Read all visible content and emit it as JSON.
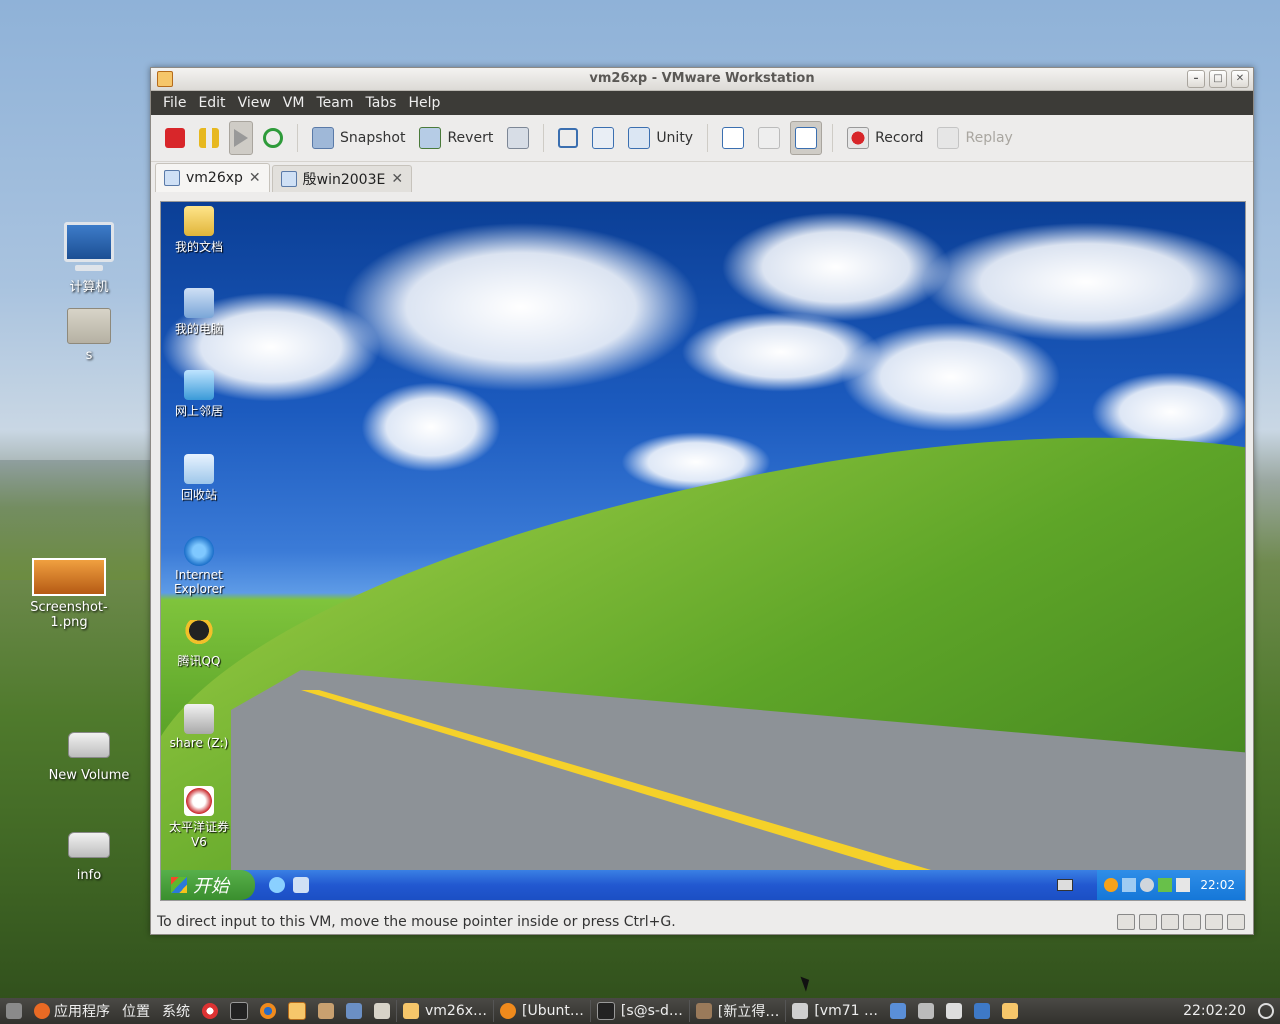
{
  "desktop": {
    "icons": [
      {
        "label": "计算机"
      },
      {
        "label": "s"
      },
      {
        "label": "Screenshot-1.png"
      },
      {
        "label": "New Volume"
      },
      {
        "label": "info"
      }
    ]
  },
  "window": {
    "title": "vm26xp - VMware Workstation",
    "menu": [
      "File",
      "Edit",
      "View",
      "VM",
      "Team",
      "Tabs",
      "Help"
    ],
    "toolbar": {
      "snapshot": "Snapshot",
      "revert": "Revert",
      "unity": "Unity",
      "record": "Record",
      "replay": "Replay"
    },
    "tabs": [
      {
        "label": "vm26xp"
      },
      {
        "label": "殷win2003E"
      }
    ],
    "status_text": "To direct input to this VM, move the mouse pointer inside or press Ctrl+G."
  },
  "guest": {
    "icons": [
      {
        "label": "我的文档"
      },
      {
        "label": "我的电脑"
      },
      {
        "label": "网上邻居"
      },
      {
        "label": "回收站"
      },
      {
        "label": "Internet Explorer"
      },
      {
        "label": "腾讯QQ"
      },
      {
        "label": "share (Z:)"
      },
      {
        "label": "太平洋证券V6"
      }
    ],
    "start_label": "开始",
    "clock": "22:02"
  },
  "panel": {
    "apps": "应用程序",
    "places": "位置",
    "system": "系统",
    "tasks": [
      "vm26x…",
      "[Ubunt…",
      "[s@s-d…",
      "[新立得…",
      "[vm71 …"
    ],
    "clock": "22:02:20"
  },
  "colors": {
    "menubar": "#3c3b37",
    "xp_taskbar": "#2258d0",
    "xp_start": "#3a8e2e"
  }
}
